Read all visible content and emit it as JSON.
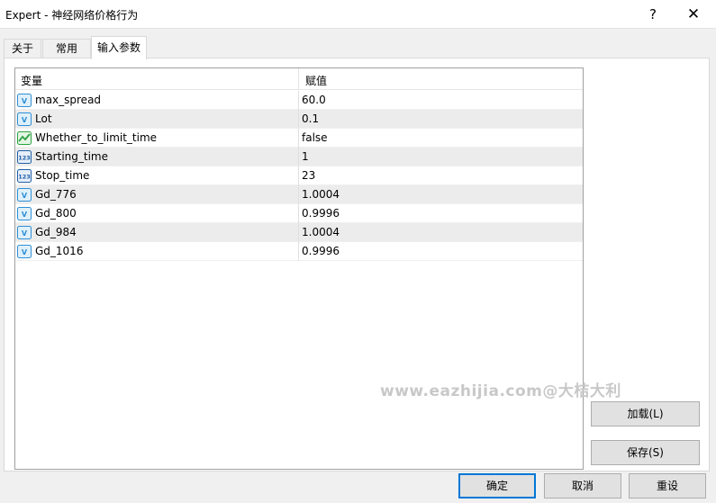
{
  "window": {
    "title": "Expert - 神经网络价格行为",
    "help_glyph": "?",
    "close_glyph": "✕"
  },
  "tabs": [
    {
      "label": "关于",
      "active": false
    },
    {
      "label": "常用",
      "active": false
    },
    {
      "label": "输入参数",
      "active": true
    }
  ],
  "table": {
    "columns": [
      "变量",
      "赋值"
    ],
    "rows": [
      {
        "name": "max_spread",
        "value": "60.0",
        "icon": "double-value-icon"
      },
      {
        "name": "Lot",
        "value": "0.1",
        "icon": "double-value-icon"
      },
      {
        "name": "Whether_to_limit_time",
        "value": "false",
        "icon": "bool-chart-icon"
      },
      {
        "name": "Starting_time",
        "value": "1",
        "icon": "integer-123-icon"
      },
      {
        "name": "Stop_time",
        "value": "23",
        "icon": "integer-123-icon"
      },
      {
        "name": "Gd_776",
        "value": "1.0004",
        "icon": "double-value-icon"
      },
      {
        "name": "Gd_800",
        "value": "0.9996",
        "icon": "double-value-icon"
      },
      {
        "name": "Gd_984",
        "value": "1.0004",
        "icon": "double-value-icon"
      },
      {
        "name": "Gd_1016",
        "value": "0.9996",
        "icon": "double-value-icon"
      }
    ]
  },
  "watermark": "www.eazhijia.com@大桔大利",
  "buttons": {
    "load": "加载(L)",
    "save": "保存(S)",
    "ok": "确定",
    "cancel": "取消",
    "reset": "重设"
  },
  "colors": {
    "icon_double": "#2e8fd6",
    "icon_bool": "#2ea043",
    "icon_int": "#1f5fa8",
    "accent": "#0078d7"
  }
}
